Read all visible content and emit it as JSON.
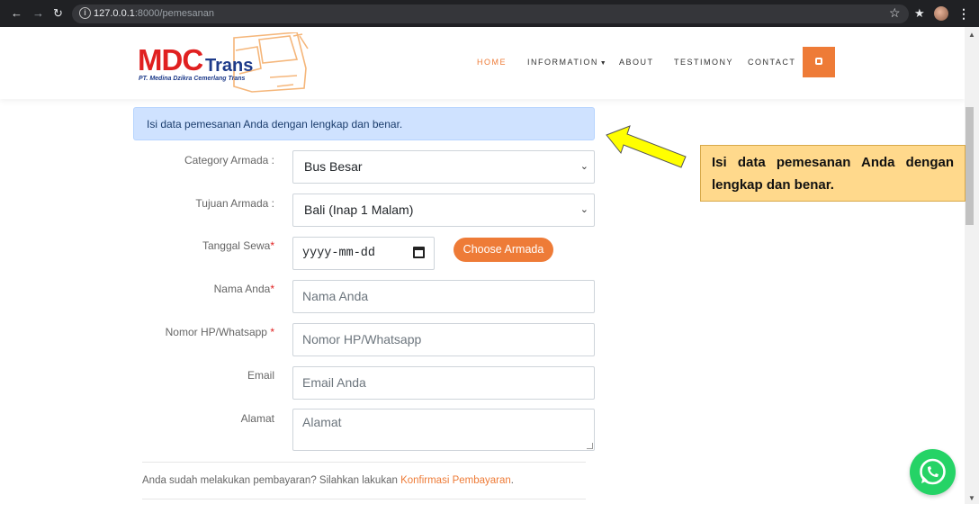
{
  "browser": {
    "url_host": "127.0.0.1",
    "url_rest": ":8000/pemesanan",
    "icons": [
      "back-icon",
      "forward-icon",
      "reload-icon",
      "site-info-icon",
      "bookmark-star-icon",
      "extensions-icon",
      "profile-avatar",
      "menu-dots-icon"
    ]
  },
  "header": {
    "logo_main": "MDC",
    "logo_sub": "Trans",
    "logo_tagline": "PT. Medina Dzikra Cemerlang Trans",
    "nav": [
      "HOME",
      "INFORMATION",
      "ABOUT",
      "TESTIMONY",
      "CONTACT"
    ],
    "cta_icon": "bus-icon",
    "accent_color": "#ee7b37"
  },
  "alert": {
    "text": "Isi data pemesanan Anda dengan lengkap dan benar."
  },
  "form": {
    "category_label": "Category Armada :",
    "category_value": "Bus Besar",
    "tujuan_label": "Tujuan Armada :",
    "tujuan_value": "Bali (Inap 1 Malam)",
    "tanggal_label": "Tanggal Sewa",
    "tanggal_placeholder": "yyyy-mm-dd",
    "choose_button": "Choose Armada",
    "nama_label": "Nama Anda",
    "nama_placeholder": "Nama Anda",
    "hp_label": "Nomor HP/Whatsapp ",
    "hp_placeholder": "Nomor HP/Whatsapp",
    "email_label": "Email",
    "email_placeholder": "Email Anda",
    "alamat_label": "Alamat",
    "alamat_placeholder": "Alamat",
    "required_mark": "*"
  },
  "footer_note": {
    "text": "Anda sudah melakukan pembayaran? Silahkan lakukan ",
    "link": "Konfirmasi Pembayaran",
    "end": "."
  },
  "annotation": {
    "line1": "Isi data pemesanan Anda dengan",
    "line2": "lengkap dan benar.",
    "color": "#ffd98c"
  },
  "floating": {
    "icon": "whatsapp-icon",
    "color": "#25d366"
  }
}
